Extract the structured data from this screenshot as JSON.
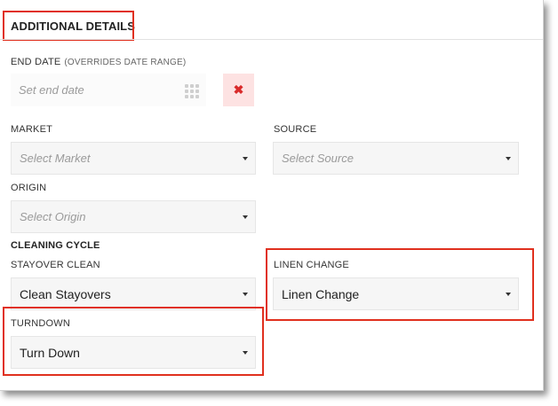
{
  "header": {
    "title": "ADDITIONAL DETAILS"
  },
  "end_date": {
    "label": "END DATE",
    "sublabel": "(OVERRIDES DATE RANGE)",
    "placeholder": "Set end date",
    "clear_symbol": "✖"
  },
  "market": {
    "label": "MARKET",
    "placeholder": "Select Market"
  },
  "source": {
    "label": "SOURCE",
    "placeholder": "Select Source"
  },
  "origin": {
    "label": "ORIGIN",
    "placeholder": "Select Origin"
  },
  "cleaning": {
    "section_title": "CLEANING CYCLE",
    "stayover": {
      "label": "STAYOVER CLEAN",
      "value": "Clean Stayovers"
    },
    "linen": {
      "label": "LINEN CHANGE",
      "value": "Linen Change"
    },
    "turndown": {
      "label": "TURNDOWN",
      "value": "Turn Down"
    }
  },
  "colors": {
    "highlight": "#e0301e",
    "field_bg": "#f6f6f6",
    "clear_bg": "#fde2e2"
  }
}
